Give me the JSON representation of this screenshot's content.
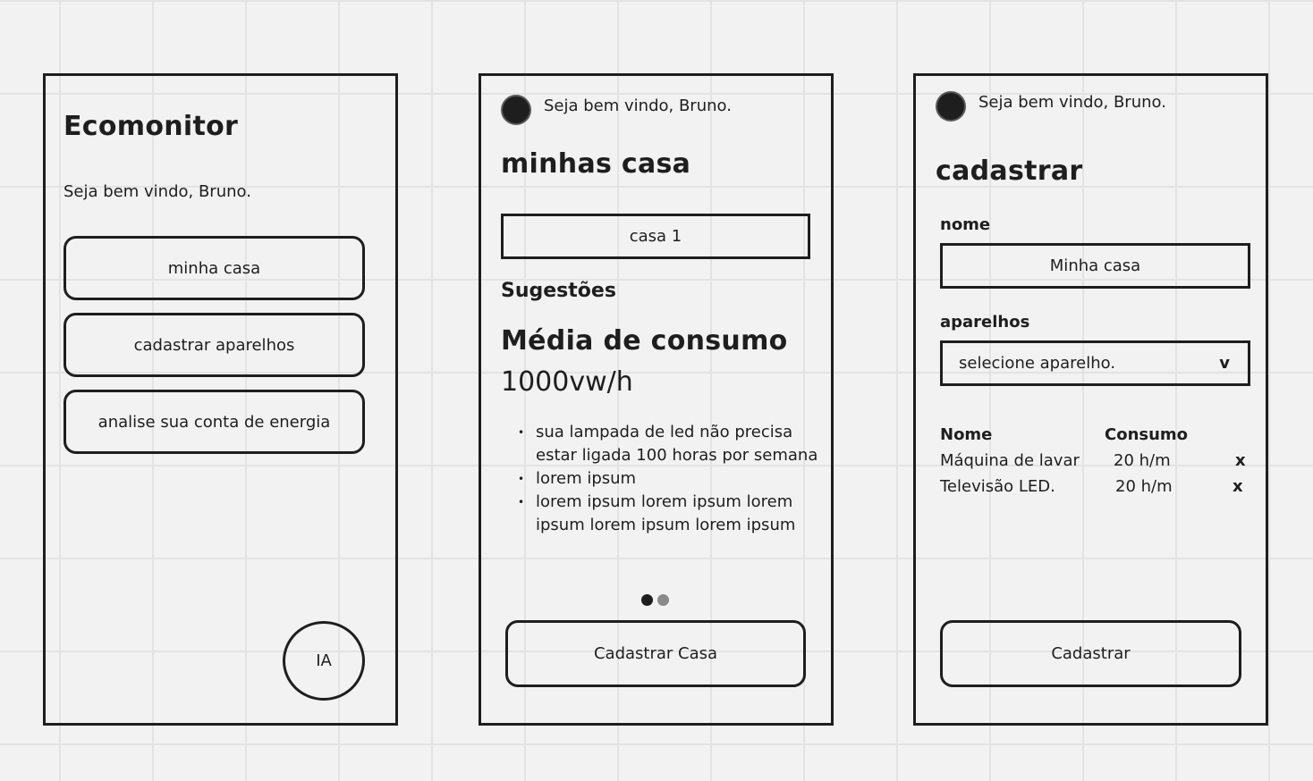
{
  "screen1": {
    "title": "Ecomonitor",
    "greeting": "Seja bem vindo, Bruno.",
    "buttons": [
      "minha casa",
      "cadastrar aparelhos",
      "analise sua conta de energia"
    ],
    "ia_label": "IA"
  },
  "screen2": {
    "greeting": "Seja bem vindo, Bruno.",
    "title": "minhas casa",
    "house_selector": "casa 1",
    "suggestions_heading": "Sugestões",
    "consumption_heading": "Média de consumo",
    "consumption_value": "1000vw/h",
    "suggestions": [
      "sua lampada de led não precisa estar ligada 100 horas por semana",
      "lorem ipsum",
      "lorem ipsum lorem ipsum lorem ipsum lorem ipsum lorem ipsum"
    ],
    "register_button": "Cadastrar Casa"
  },
  "screen3": {
    "greeting": "Seja bem vindo, Bruno.",
    "title": "cadastrar",
    "name_label": "nome",
    "name_value": "Minha casa",
    "devices_label": "aparelhos",
    "devices_select": "selecione aparelho.",
    "select_chevron": "v",
    "table": {
      "headers": [
        "Nome",
        "Consumo"
      ],
      "rows": [
        {
          "name": "Máquina de lavar",
          "consumption": "20 h/m",
          "remove": "x"
        },
        {
          "name": "Televisão LED.",
          "consumption": "20 h/m",
          "remove": "x"
        }
      ]
    },
    "submit_button": "Cadastrar"
  }
}
